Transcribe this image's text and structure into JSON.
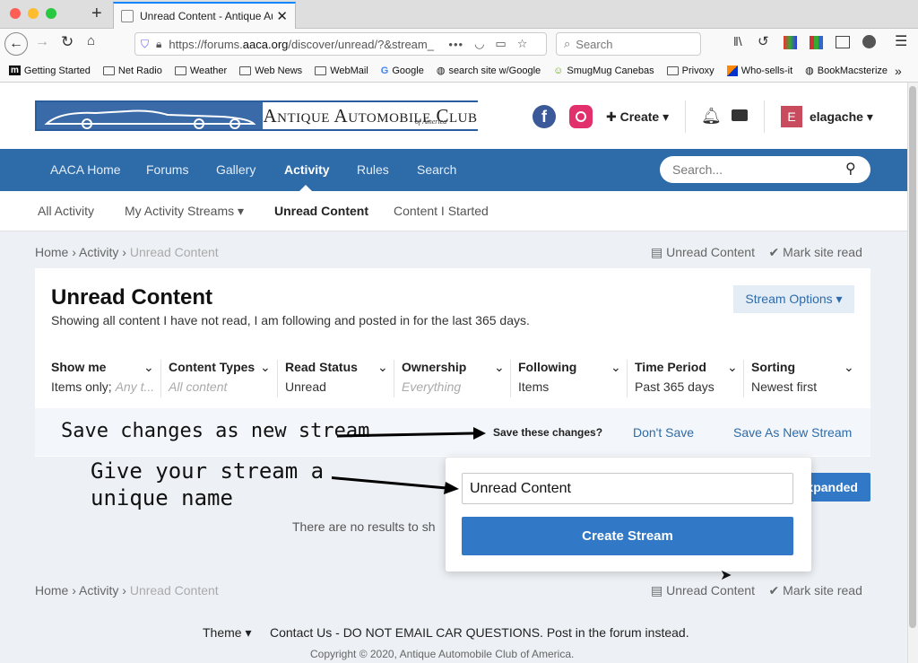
{
  "browser": {
    "tab_title": "Unread Content - Antique Auto",
    "url_prefix": "https://forums.",
    "url_domain": "aaca.org",
    "url_rest": "/discover/unread/?&stream_",
    "search_placeholder": "Search",
    "bookmarks": [
      "Getting Started",
      "Net Radio",
      "Weather",
      "Web News",
      "WebMail",
      "Google",
      "search site w/Google",
      "SmugMug Canebas",
      "Privoxy",
      "Who-sells-it",
      "BookMacsterize"
    ]
  },
  "site": {
    "logo_text": "Antique Automobile Club",
    "logo_sub": "of America",
    "create_label": "Create",
    "user_initial": "E",
    "username": "elagache",
    "nav": [
      "AACA Home",
      "Forums",
      "Gallery",
      "Activity",
      "Rules",
      "Search"
    ],
    "search_placeholder": "Search...",
    "subnav": [
      "All Activity",
      "My Activity Streams",
      "Unread Content",
      "Content I Started"
    ]
  },
  "breadcrumb": {
    "home": "Home",
    "activity": "Activity",
    "current": "Unread Content"
  },
  "crumb_actions": {
    "unread": "Unread Content",
    "mark": "Mark site read"
  },
  "page": {
    "title": "Unread Content",
    "description": "Showing all content I have not read, I am following and posted in for the last 365 days.",
    "stream_options": "Stream Options"
  },
  "filters": [
    {
      "label": "Show me",
      "value": "Items only;",
      "extra": "Any t..."
    },
    {
      "label": "Content Types",
      "placeholder": "All content"
    },
    {
      "label": "Read Status",
      "value": "Unread"
    },
    {
      "label": "Ownership",
      "placeholder": "Everything"
    },
    {
      "label": "Following",
      "value": "Items"
    },
    {
      "label": "Time Period",
      "value": "Past 365 days"
    },
    {
      "label": "Sorting",
      "value": "Newest first"
    }
  ],
  "savebar": {
    "question": "Save these changes?",
    "dont_save": "Don't Save",
    "save_new": "Save As New Stream"
  },
  "popup": {
    "input_value": "Unread Content",
    "create": "Create Stream"
  },
  "expanded_label": "xpanded",
  "no_results": "There are no results to sh",
  "annotations": {
    "save": "Save changes as new stream",
    "name_line1": "Give your stream a",
    "name_line2": "unique name"
  },
  "footer": {
    "theme": "Theme",
    "contact": "Contact Us - DO NOT EMAIL CAR QUESTIONS. Post in the forum instead.",
    "copyright": "Copyright © 2020, Antique Automobile Club of America."
  },
  "colors": {
    "nav": "#2d6ba9",
    "primary_button": "#3178c6",
    "link": "#2d6ba9",
    "facebook": "#3b5998",
    "instagram": "#e1306c"
  }
}
